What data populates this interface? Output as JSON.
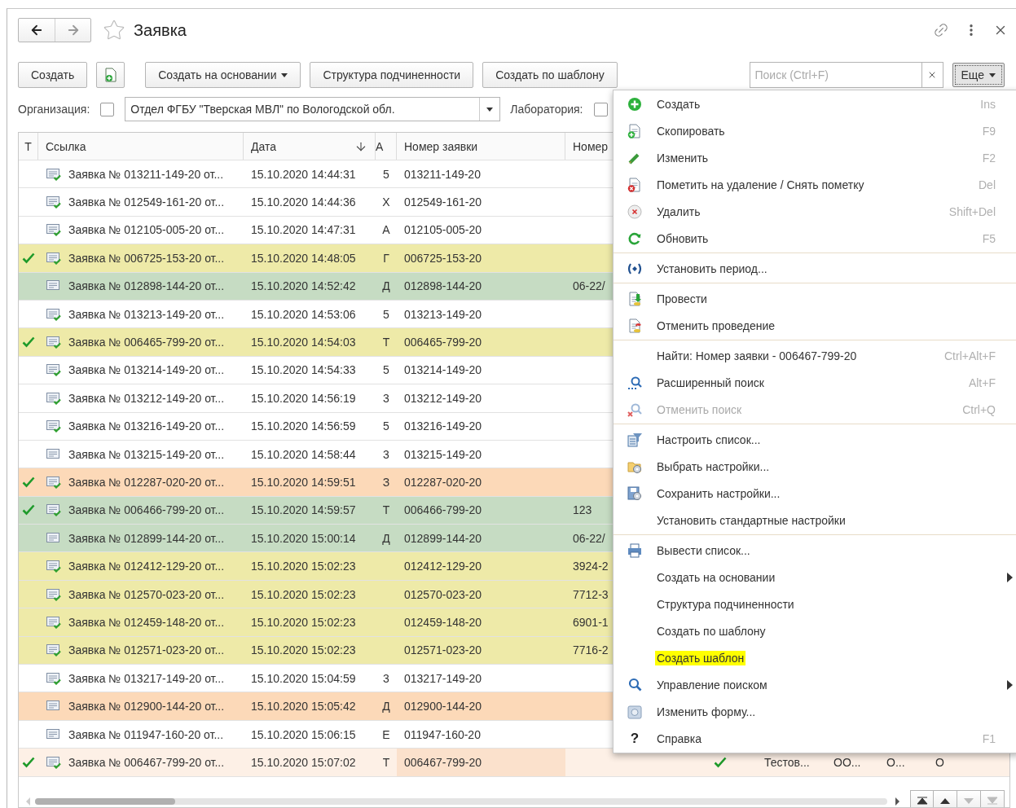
{
  "window": {
    "title": "Заявка"
  },
  "toolbar": {
    "buttons": [
      {
        "kind": "text",
        "label": "Создать"
      },
      {
        "kind": "icon"
      },
      {
        "kind": "dropdown",
        "label": "Создать на основании"
      },
      {
        "kind": "text",
        "label": "Структура подчиненности"
      },
      {
        "kind": "text",
        "label": "Создать по шаблону"
      }
    ],
    "search": {
      "placeholder": "Поиск (Ctrl+F)"
    },
    "more": {
      "label": "Еще",
      "pressed": true
    }
  },
  "filters": {
    "organization": {
      "label": "Организация:",
      "checked": false,
      "value": "Отдел ФГБУ \"Тверская МВЛ\" по Вологодской обл."
    },
    "laboratory": {
      "label": "Лаборатория:",
      "checked": false
    }
  },
  "table": {
    "columns": [
      {
        "label": "Т",
        "sorted": false
      },
      {
        "label": "Ссылка",
        "sorted": false
      },
      {
        "label": "Дата",
        "sorted": true
      },
      {
        "label": "А",
        "sorted": false
      },
      {
        "label": "Номер заявки",
        "sorted": false
      },
      {
        "label": "Номер",
        "sorted": false
      }
    ],
    "rows": [
      {
        "kind": "posted",
        "marked": false,
        "selected": false,
        "color": "#ffffff",
        "ref": "Заявка № 013211-149-20 от...",
        "date": "15.10.2020 14:44:31",
        "a": "5",
        "number": "013211-149-20"
      },
      {
        "kind": "posted",
        "marked": false,
        "selected": false,
        "color": "#ffffff",
        "ref": "Заявка № 012549-161-20 от...",
        "date": "15.10.2020 14:44:36",
        "a": "Х",
        "number": "012549-161-20"
      },
      {
        "kind": "posted",
        "marked": false,
        "selected": false,
        "color": "#ffffff",
        "ref": "Заявка № 012105-005-20 от...",
        "date": "15.10.2020 14:47:31",
        "a": "А",
        "number": "012105-005-20"
      },
      {
        "kind": "posted",
        "marked": true,
        "selected": false,
        "color": "#eeeaa8",
        "ref": "Заявка № 006725-153-20 от...",
        "date": "15.10.2020 14:48:05",
        "a": "Г",
        "number": "006725-153-20"
      },
      {
        "kind": "plain",
        "marked": false,
        "selected": false,
        "color": "#c6dcc3",
        "ref": "Заявка № 012898-144-20 от...",
        "date": "15.10.2020 14:52:42",
        "a": "Д",
        "number": "012898-144-20",
        "number2": "06-22/"
      },
      {
        "kind": "posted",
        "marked": false,
        "selected": false,
        "color": "#ffffff",
        "ref": "Заявка № 013213-149-20 от...",
        "date": "15.10.2020 14:53:06",
        "a": "5",
        "number": "013213-149-20"
      },
      {
        "kind": "posted",
        "marked": true,
        "selected": false,
        "color": "#eeeaa8",
        "ref": "Заявка № 006465-799-20 от...",
        "date": "15.10.2020 14:54:03",
        "a": "Т",
        "number": "006465-799-20"
      },
      {
        "kind": "posted",
        "marked": false,
        "selected": false,
        "color": "#ffffff",
        "ref": "Заявка № 013214-149-20 от...",
        "date": "15.10.2020 14:54:33",
        "a": "5",
        "number": "013214-149-20"
      },
      {
        "kind": "posted",
        "marked": false,
        "selected": false,
        "color": "#ffffff",
        "ref": "Заявка № 013212-149-20 от...",
        "date": "15.10.2020 14:56:19",
        "a": "3",
        "number": "013212-149-20"
      },
      {
        "kind": "posted",
        "marked": false,
        "selected": false,
        "color": "#ffffff",
        "ref": "Заявка № 013216-149-20 от...",
        "date": "15.10.2020 14:56:59",
        "a": "5",
        "number": "013216-149-20"
      },
      {
        "kind": "plain",
        "marked": false,
        "selected": false,
        "color": "#ffffff",
        "ref": "Заявка № 013215-149-20 от...",
        "date": "15.10.2020 14:58:44",
        "a": "3",
        "number": "013215-149-20"
      },
      {
        "kind": "posted",
        "marked": true,
        "selected": false,
        "color": "#fcd9b8",
        "ref": "Заявка № 012287-020-20 от...",
        "date": "15.10.2020 14:59:51",
        "a": "З",
        "number": "012287-020-20"
      },
      {
        "kind": "posted",
        "marked": true,
        "selected": false,
        "color": "#c6dcc3",
        "ref": "Заявка № 006466-799-20 от...",
        "date": "15.10.2020 14:59:57",
        "a": "Т",
        "number": "006466-799-20",
        "number2": "123"
      },
      {
        "kind": "plain",
        "marked": false,
        "selected": false,
        "color": "#c6dcc3",
        "ref": "Заявка № 012899-144-20 от...",
        "date": "15.10.2020 15:00:14",
        "a": "Д",
        "number": "012899-144-20",
        "number2": "06-22/"
      },
      {
        "kind": "posted",
        "marked": false,
        "selected": false,
        "color": "#eeeaa8",
        "ref": "Заявка № 012412-129-20 от...",
        "date": "15.10.2020 15:02:23",
        "number": "012412-129-20",
        "number2": "3924-2"
      },
      {
        "kind": "posted",
        "marked": false,
        "selected": false,
        "color": "#eeeaa8",
        "ref": "Заявка № 012570-023-20 от...",
        "date": "15.10.2020 15:02:23",
        "number": "012570-023-20",
        "number2": "7712-3"
      },
      {
        "kind": "posted",
        "marked": false,
        "selected": false,
        "color": "#eeeaa8",
        "ref": "Заявка № 012459-148-20 от...",
        "date": "15.10.2020 15:02:23",
        "number": "012459-148-20",
        "number2": "6901-1"
      },
      {
        "kind": "posted",
        "marked": false,
        "selected": false,
        "color": "#eeeaa8",
        "ref": "Заявка № 012571-023-20 от...",
        "date": "15.10.2020 15:02:23",
        "number": "012571-023-20",
        "number2": "7716-2"
      },
      {
        "kind": "posted",
        "marked": false,
        "selected": false,
        "color": "#ffffff",
        "ref": "Заявка № 013217-149-20 от...",
        "date": "15.10.2020 15:04:59",
        "a": "3",
        "number": "013217-149-20"
      },
      {
        "kind": "plain",
        "marked": false,
        "selected": false,
        "color": "#fcd9b8",
        "ref": "Заявка № 012900-144-20 от...",
        "date": "15.10.2020 15:05:42",
        "a": "Д",
        "number": "012900-144-20"
      },
      {
        "kind": "plain",
        "marked": false,
        "selected": false,
        "color": "#ffffff",
        "ref": "Заявка № 011947-160-20 от...",
        "date": "15.10.2020 15:06:15",
        "a": "Е",
        "number": "011947-160-20"
      },
      {
        "kind": "posted",
        "marked": true,
        "selected": true,
        "color": "#fdf0e6",
        "ref": "Заявка № 006467-799-20 от...",
        "date": "15.10.2020 15:07:02",
        "a": "Т",
        "number": "006467-799-20",
        "extra": {
          "approved": true,
          "cells": [
            "Тестов...",
            "ОО...",
            "О...",
            "О"
          ]
        }
      }
    ]
  },
  "menu": {
    "groups": [
      [
        {
          "label": "Создать",
          "shortcut": "Ins",
          "disabled": false,
          "submenu": false,
          "highlighted": false
        },
        {
          "label": "Скопировать",
          "shortcut": "F9",
          "disabled": false,
          "submenu": false,
          "highlighted": false
        },
        {
          "label": "Изменить",
          "shortcut": "F2",
          "disabled": false,
          "submenu": false,
          "highlighted": false
        },
        {
          "label": "Пометить на удаление / Снять пометку",
          "shortcut": "Del",
          "disabled": false,
          "submenu": false,
          "highlighted": false
        },
        {
          "label": "Удалить",
          "shortcut": "Shift+Del",
          "disabled": false,
          "submenu": false,
          "highlighted": false
        },
        {
          "label": "Обновить",
          "shortcut": "F5",
          "disabled": false,
          "submenu": false,
          "highlighted": false
        }
      ],
      [
        {
          "label": "Установить период...",
          "disabled": false,
          "submenu": false,
          "highlighted": false
        }
      ],
      [
        {
          "label": "Провести",
          "disabled": false,
          "submenu": false,
          "highlighted": false
        },
        {
          "label": "Отменить проведение",
          "disabled": false,
          "submenu": false,
          "highlighted": false
        }
      ],
      [
        {
          "label": "Найти: Номер заявки - 006467-799-20",
          "shortcut": "Ctrl+Alt+F",
          "disabled": false,
          "submenu": false,
          "highlighted": false
        },
        {
          "label": "Расширенный поиск",
          "shortcut": "Alt+F",
          "disabled": false,
          "submenu": false,
          "highlighted": false
        },
        {
          "label": "Отменить поиск",
          "shortcut": "Ctrl+Q",
          "disabled": true,
          "submenu": false,
          "highlighted": false
        }
      ],
      [
        {
          "label": "Настроить список...",
          "disabled": false,
          "submenu": false,
          "highlighted": false
        },
        {
          "label": "Выбрать настройки...",
          "disabled": false,
          "submenu": false,
          "highlighted": false
        },
        {
          "label": "Сохранить настройки...",
          "disabled": false,
          "submenu": false,
          "highlighted": false
        },
        {
          "label": "Установить стандартные настройки",
          "disabled": false,
          "submenu": false,
          "highlighted": false
        }
      ],
      [
        {
          "label": "Вывести список...",
          "disabled": false,
          "submenu": false,
          "highlighted": false
        },
        {
          "label": "Создать на основании",
          "disabled": false,
          "submenu": true,
          "highlighted": false
        },
        {
          "label": "Структура подчиненности",
          "disabled": false,
          "submenu": false,
          "highlighted": false
        },
        {
          "label": "Создать по шаблону",
          "disabled": false,
          "submenu": false,
          "highlighted": false
        },
        {
          "label": "Создать шаблон",
          "disabled": false,
          "submenu": false,
          "highlighted": true
        },
        {
          "label": "Управление поиском",
          "disabled": false,
          "submenu": true,
          "highlighted": false
        },
        {
          "label": "Изменить форму...",
          "disabled": false,
          "submenu": false,
          "highlighted": false
        },
        {
          "label": "Справка",
          "glyph": "?",
          "shortcut": "F1",
          "disabled": false,
          "submenu": false,
          "highlighted": false
        }
      ]
    ]
  }
}
